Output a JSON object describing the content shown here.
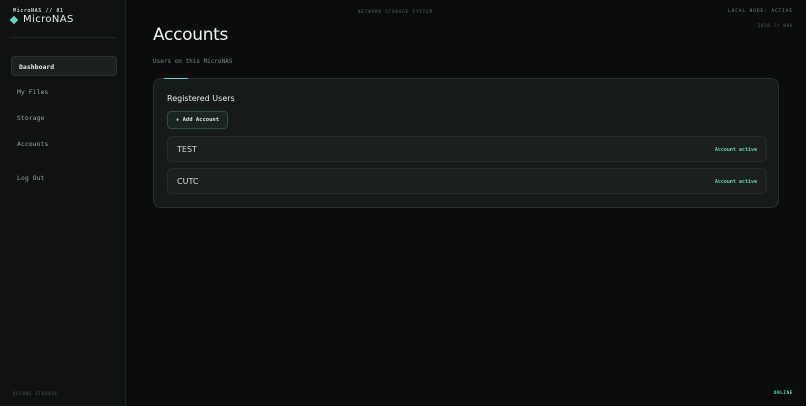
{
  "sidebar": {
    "brand_sub": "MicroNAS // 01",
    "brand_name": "MicroNAS",
    "items": [
      {
        "label": "Dashboard"
      },
      {
        "label": "My Files"
      },
      {
        "label": "Storage"
      },
      {
        "label": "Accounts"
      },
      {
        "label": "Log Out"
      }
    ],
    "footer": "SECURE STORAGE"
  },
  "topbar": {
    "center": "NETWORK STORAGE SYSTEM",
    "right": "LOCAL NODE: ACTIVE",
    "right_sub": "2026 // NAS"
  },
  "page": {
    "title": "Accounts",
    "subtitle": "Users on this MicroNAS"
  },
  "card": {
    "title": "Registered Users",
    "add_label": "+ Add Account",
    "users": [
      {
        "name": "TEST",
        "status": "Account active"
      },
      {
        "name": "CUTC",
        "status": "Account active"
      }
    ]
  },
  "status": {
    "label": "ONLINE"
  },
  "colors": {
    "accent": "#5fd7c9",
    "active": "#5fd7a6",
    "background": "#0b0d0d"
  }
}
